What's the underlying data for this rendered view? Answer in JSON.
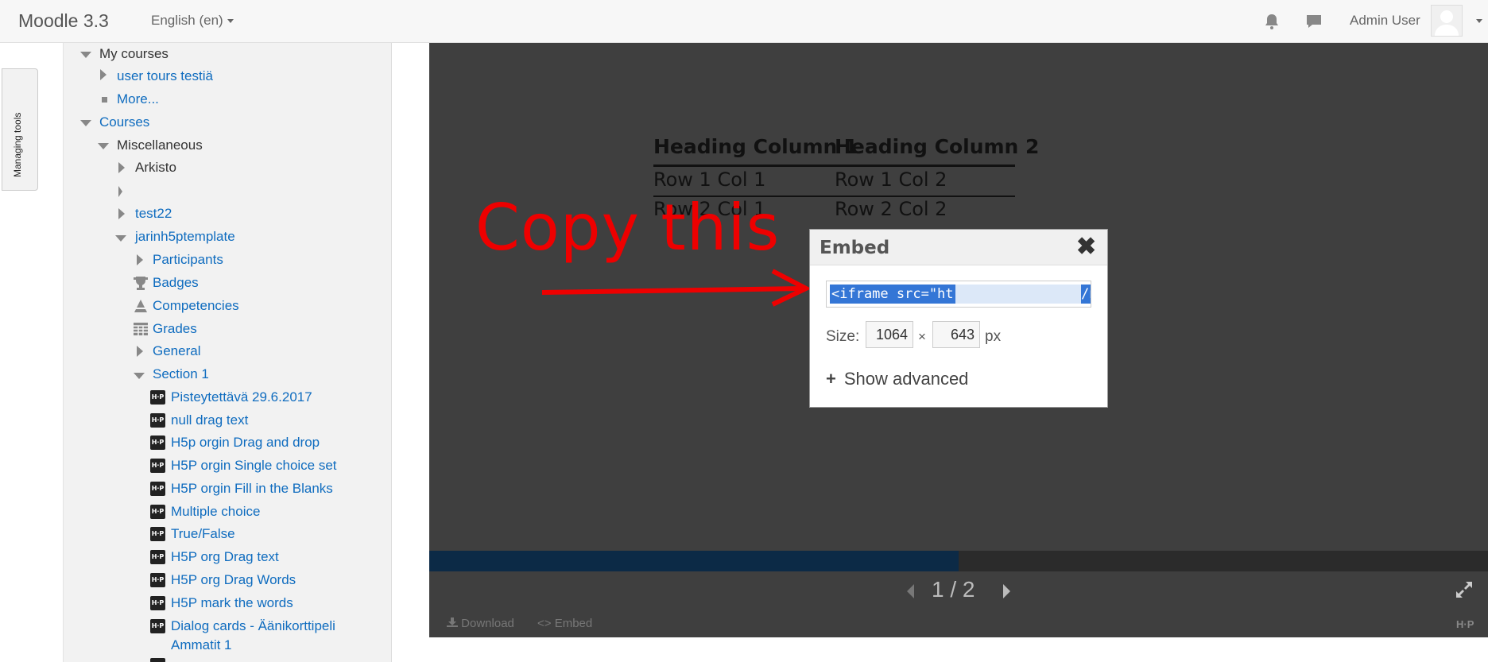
{
  "navbar": {
    "brand": "Moodle 3.3",
    "language": "English (en)",
    "notifications_icon": "bell-icon",
    "messages_icon": "chat-icon",
    "username": "Admin User"
  },
  "managing_tools": "Managing tools",
  "nav_tree": {
    "my_courses": "My courses",
    "user_tours": "user tours testiä",
    "more": "More...",
    "courses": "Courses",
    "miscellaneous": "Miscellaneous",
    "arkisto": "Arkisto",
    "empty": "",
    "test22": "test22",
    "course": "jarinh5ptemplate",
    "participants": "Participants",
    "badges": "Badges",
    "competencies": "Competencies",
    "grades": "Grades",
    "general": "General",
    "section1": "Section 1",
    "activities": [
      "Pisteytettävä 29.6.2017",
      "null drag text",
      "H5p orgin Drag and drop",
      "H5P orgin Single choice set",
      "H5P orgin Fill in the Blanks",
      "Multiple choice",
      "True/False",
      "H5P org Drag text",
      "H5P org Drag Words",
      "H5P mark the words",
      "Dialog cards - Äänikorttipeli",
      "Ammatit 1"
    ],
    "activity_icon_label": "H·P"
  },
  "content_table": {
    "headers": [
      "Heading Column 1",
      "Heading Column 2"
    ],
    "rows": [
      [
        "Row 1 Col 1",
        "Row 1 Col 2"
      ],
      [
        "Row 2 Col 1",
        "Row 2 Col 2"
      ]
    ]
  },
  "annotation": {
    "text": "Copy this",
    "color": "#ee0000"
  },
  "embed_dialog": {
    "title": "Embed",
    "close": "✖",
    "code_visible": "<iframe src=\"ht",
    "code_tail": "/n",
    "size_label": "Size:",
    "width": "1064",
    "times": "×",
    "height": "643",
    "unit": "px",
    "show_advanced_plus": "+",
    "show_advanced": "Show advanced"
  },
  "player": {
    "progress": 0.5,
    "page_indicator": "1 / 2",
    "download": "Download",
    "embed": "Embed",
    "logo": "H·P",
    "colors": {
      "background": "#3f3f3f",
      "progress": "#0c2a46",
      "track": "#2b2b2b"
    }
  }
}
